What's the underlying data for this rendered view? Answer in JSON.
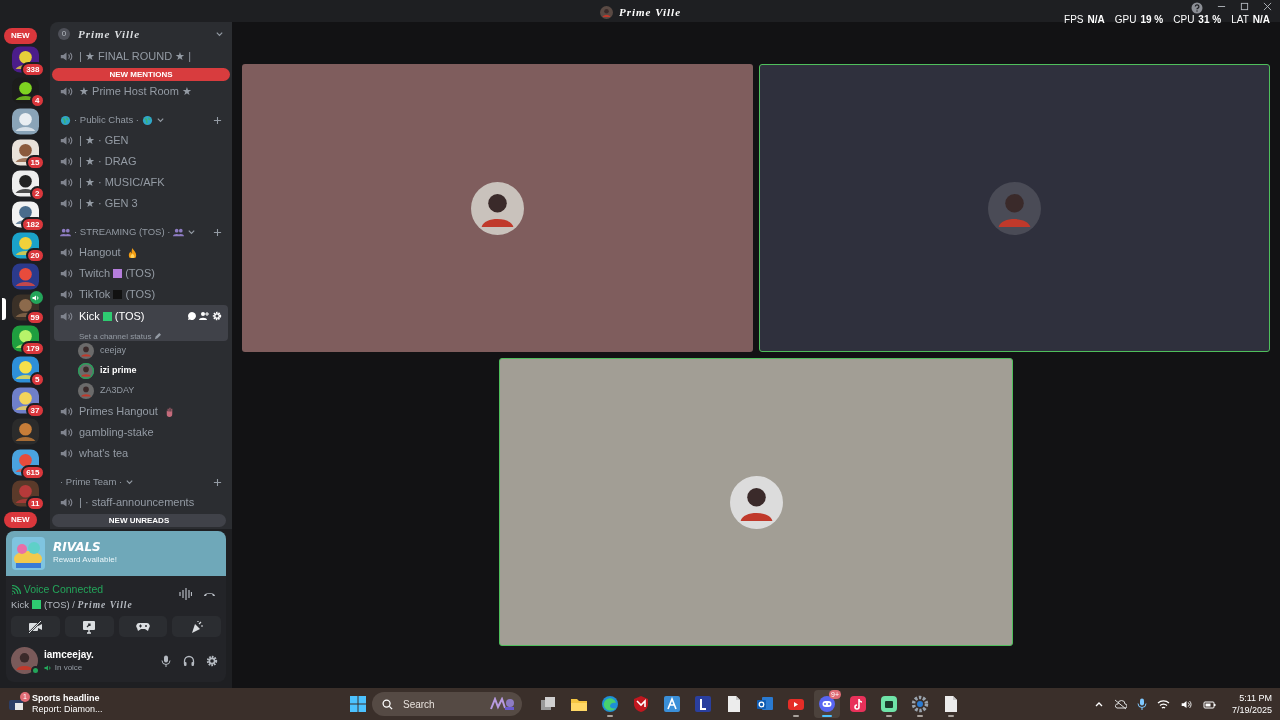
{
  "title_bar": {
    "server_name": "Prime Ville"
  },
  "overlay_stats": [
    {
      "label": "FPS",
      "value": "N/A"
    },
    {
      "label": "GPU",
      "value": "19 %"
    },
    {
      "label": "CPU",
      "value": "31 %"
    },
    {
      "label": "LAT",
      "value": "N/A"
    }
  ],
  "server_rail": {
    "top_pill": "NEW",
    "bottom_pill": "NEW",
    "servers": [
      {
        "badge": "338",
        "selected": false,
        "in_voice": false
      },
      {
        "badge": "4",
        "selected": false,
        "in_voice": false
      },
      {
        "selected": false,
        "in_voice": false
      },
      {
        "badge": "15",
        "selected": false,
        "in_voice": false
      },
      {
        "badge": "2",
        "selected": false,
        "in_voice": false
      },
      {
        "badge": "182",
        "selected": false,
        "in_voice": false
      },
      {
        "badge": "20",
        "selected": false,
        "in_voice": false
      },
      {
        "selected": false,
        "in_voice": false
      },
      {
        "badge": "59",
        "selected": true,
        "in_voice": true
      },
      {
        "badge": "179",
        "selected": false,
        "in_voice": false
      },
      {
        "badge": "5",
        "selected": false,
        "in_voice": false
      },
      {
        "badge": "37",
        "selected": false,
        "in_voice": false
      },
      {
        "selected": false,
        "in_voice": false
      },
      {
        "badge": "615",
        "selected": false,
        "in_voice": false
      },
      {
        "badge": "11",
        "selected": false,
        "in_voice": false
      }
    ]
  },
  "channel_panel": {
    "boost_count": "0",
    "server_name": "Prime Ville",
    "new_mentions": "NEW MENTIONS",
    "new_unreads": "NEW UNREADS",
    "items": [
      {
        "kind": "channel",
        "name": "| ★ FINAL ROUND ★ |",
        "selected": false
      },
      {
        "kind": "mentions"
      },
      {
        "kind": "channel",
        "name": "★ Prime Host Room ★",
        "selected": false
      },
      {
        "kind": "category",
        "name": "· Public Chats ·",
        "emoji": {
          "kind": "globe"
        }
      },
      {
        "kind": "channel",
        "name": "| ★ · GEN",
        "selected": false
      },
      {
        "kind": "channel",
        "name": "| ★ · DRAG",
        "selected": false
      },
      {
        "kind": "channel",
        "name": "| ★ · MUSIC/AFK",
        "selected": false
      },
      {
        "kind": "channel",
        "name": "| ★ · GEN 3",
        "selected": false
      },
      {
        "kind": "category",
        "name": "· STREAMING (TOS) ·",
        "emoji": {
          "kind": "people"
        }
      },
      {
        "kind": "channel",
        "name": "Hangout",
        "emoji": {
          "kind": "flame"
        },
        "selected": false
      },
      {
        "kind": "channel",
        "name": "Twitch",
        "color": "#b57edc",
        "suffix": "(TOS)",
        "selected": false
      },
      {
        "kind": "channel",
        "name": "TikTok",
        "color": "#111111",
        "suffix": "(TOS)",
        "selected": false
      },
      {
        "kind": "channel",
        "name": "Kick",
        "color": "#2ecc71",
        "suffix": "(TOS)",
        "selected": true,
        "status": "Set a channel status"
      },
      {
        "kind": "member",
        "name": "ceejay",
        "speaking": false
      },
      {
        "kind": "member",
        "name": "izi prime",
        "speaking": true
      },
      {
        "kind": "member",
        "name": "ZA3DAY",
        "speaking": false
      },
      {
        "kind": "channel",
        "name": "Primes Hangout",
        "emoji": {
          "kind": "hand"
        },
        "selected": false
      },
      {
        "kind": "channel",
        "name": "gambling-stake",
        "selected": false
      },
      {
        "kind": "channel",
        "name": "what's tea",
        "selected": false
      },
      {
        "kind": "category",
        "name": "· Prime Team ·"
      },
      {
        "kind": "channel",
        "name": "| · staff-announcements",
        "selected": false
      }
    ]
  },
  "promo": {
    "logo": "RIVALS",
    "text": "Reward Available!"
  },
  "voice_panel": {
    "status": "Voice Connected",
    "channel": "Kick",
    "color": "#2ecc71",
    "channel_suffix": "(TOS) /",
    "server": "Prime Ville"
  },
  "user_panel": {
    "name": "iamceejay.",
    "status": "In voice"
  },
  "video_tiles": [
    {
      "color": "#7f5d5d",
      "speaking": false
    },
    {
      "color": "#2f303d",
      "speaking": true
    },
    {
      "color": "#a29e95",
      "speaking": true
    }
  ],
  "taskbar": {
    "widget": {
      "count": "1",
      "title": "Sports headline",
      "text": "Report: Diamon..."
    },
    "search_placeholder": "Search",
    "apps": [
      {
        "kind": "taskview",
        "running": false,
        "active": false
      },
      {
        "kind": "folder",
        "running": false,
        "active": false
      },
      {
        "kind": "edge",
        "running": true,
        "active": false
      },
      {
        "kind": "shield",
        "running": false,
        "active": false
      },
      {
        "kind": "a-app",
        "running": false,
        "active": false
      },
      {
        "kind": "l-app",
        "running": false,
        "active": false
      },
      {
        "kind": "doc",
        "running": false,
        "active": false
      },
      {
        "kind": "mail",
        "running": false,
        "active": false
      },
      {
        "kind": "play",
        "running": true,
        "active": false
      },
      {
        "kind": "chat",
        "running": true,
        "active": true,
        "badge": "9+"
      },
      {
        "kind": "note",
        "running": false,
        "active": false
      },
      {
        "kind": "green-app",
        "running": true,
        "active": false
      },
      {
        "kind": "gear",
        "running": true,
        "active": false
      },
      {
        "kind": "doc",
        "running": true,
        "active": false
      }
    ],
    "time": "5:11 PM",
    "date": "7/19/2025"
  }
}
